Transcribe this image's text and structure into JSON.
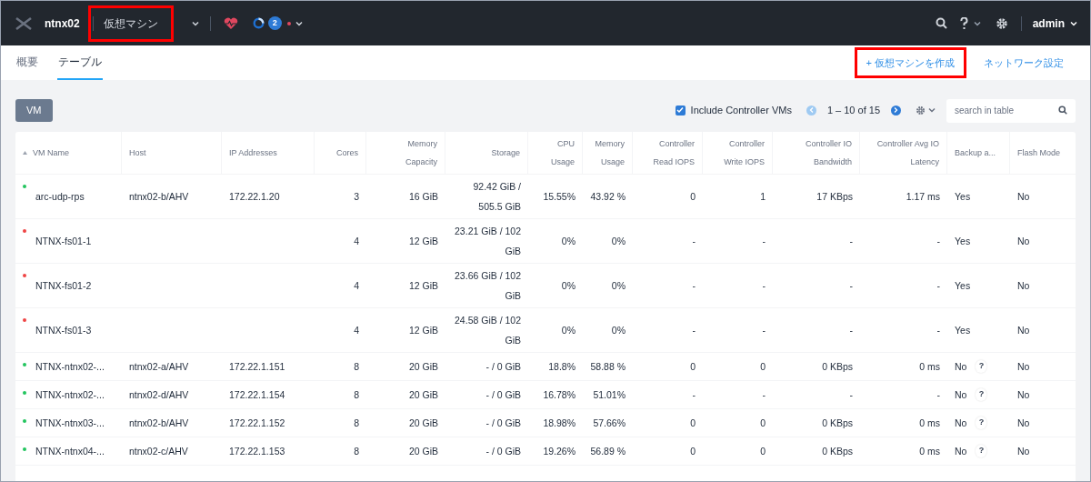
{
  "topbar": {
    "cluster": "ntnx02",
    "section": {
      "label": "仮想マシン",
      "highlighted": true
    },
    "alert_count": "2",
    "user": "admin"
  },
  "tabs": [
    {
      "label": "概要",
      "selected": false
    },
    {
      "label": "テーブル",
      "selected": true
    }
  ],
  "actions": [
    {
      "label": "+ 仮想マシンを作成",
      "highlighted": true
    },
    {
      "label": "ネットワーク設定",
      "highlighted": false
    }
  ],
  "toolbar": {
    "view_button": "VM",
    "include_cvms": {
      "label": "Include Controller VMs",
      "checked": true
    },
    "prev_disabled": true,
    "next_disabled": false,
    "range": "1 – 10 of 15",
    "search": {
      "placeholder": "search in table"
    }
  },
  "table": {
    "columns": [
      "VM Name",
      "Host",
      "IP Addresses",
      "Cores",
      "Memory Capacity",
      "Storage",
      "CPU Usage",
      "Memory Usage",
      "Controller Read IOPS",
      "Controller Write IOPS",
      "Controller IO Bandwidth",
      "Controller Avg IO Latency",
      "Backup a...",
      "Flash Mode"
    ],
    "rows": [
      {
        "color": "#22c55e",
        "cells": [
          "arc-udp-rps",
          "ntnx02-b/AHV",
          "172.22.1.20",
          "3",
          "16 GiB",
          "92.42 GiB / 505.5 GiB",
          "15.55%",
          "43.92 %",
          "0",
          "1",
          "17 KBps",
          "1.17 ms",
          "Yes",
          "No"
        ]
      },
      {
        "color": "#ef4444",
        "cells": [
          "NTNX-fs01-1",
          "",
          "",
          "4",
          "12 GiB",
          "23.21 GiB / 102 GiB",
          "0%",
          "0%",
          "-",
          "-",
          "-",
          "-",
          "Yes",
          "No"
        ]
      },
      {
        "color": "#ef4444",
        "cells": [
          "NTNX-fs01-2",
          "",
          "",
          "4",
          "12 GiB",
          "23.66 GiB / 102 GiB",
          "0%",
          "0%",
          "-",
          "-",
          "-",
          "-",
          "Yes",
          "No"
        ]
      },
      {
        "color": "#ef4444",
        "cells": [
          "NTNX-fs01-3",
          "",
          "",
          "4",
          "12 GiB",
          "24.58 GiB / 102 GiB",
          "0%",
          "0%",
          "-",
          "-",
          "-",
          "-",
          "Yes",
          "No"
        ]
      },
      {
        "color": "#22c55e",
        "help": "?",
        "cells": [
          "NTNX-ntnx02-...",
          "ntnx02-a/AHV",
          "172.22.1.151",
          "8",
          "20 GiB",
          "- / 0 GiB",
          "18.8%",
          "58.88 %",
          "0",
          "0",
          "0 KBps",
          "0 ms",
          "No",
          "No"
        ]
      },
      {
        "color": "#22c55e",
        "help": "?",
        "cells": [
          "NTNX-ntnx02-...",
          "ntnx02-d/AHV",
          "172.22.1.154",
          "8",
          "20 GiB",
          "- / 0 GiB",
          "16.78%",
          "51.01%",
          "-",
          "-",
          "-",
          "-",
          "No",
          "No"
        ]
      },
      {
        "color": "#22c55e",
        "help": "?",
        "cells": [
          "NTNX-ntnx03-...",
          "ntnx02-b/AHV",
          "172.22.1.152",
          "8",
          "20 GiB",
          "- / 0 GiB",
          "18.98%",
          "57.66%",
          "0",
          "0",
          "0 KBps",
          "0 ms",
          "No",
          "No"
        ]
      },
      {
        "color": "#22c55e",
        "help": "?",
        "cells": [
          "NTNX-ntnx04-...",
          "ntnx02-c/AHV",
          "172.22.1.153",
          "8",
          "20 GiB",
          "- / 0 GiB",
          "19.26%",
          "56.89 %",
          "0",
          "0",
          "0 KBps",
          "0 ms",
          "No",
          "No"
        ]
      }
    ]
  }
}
